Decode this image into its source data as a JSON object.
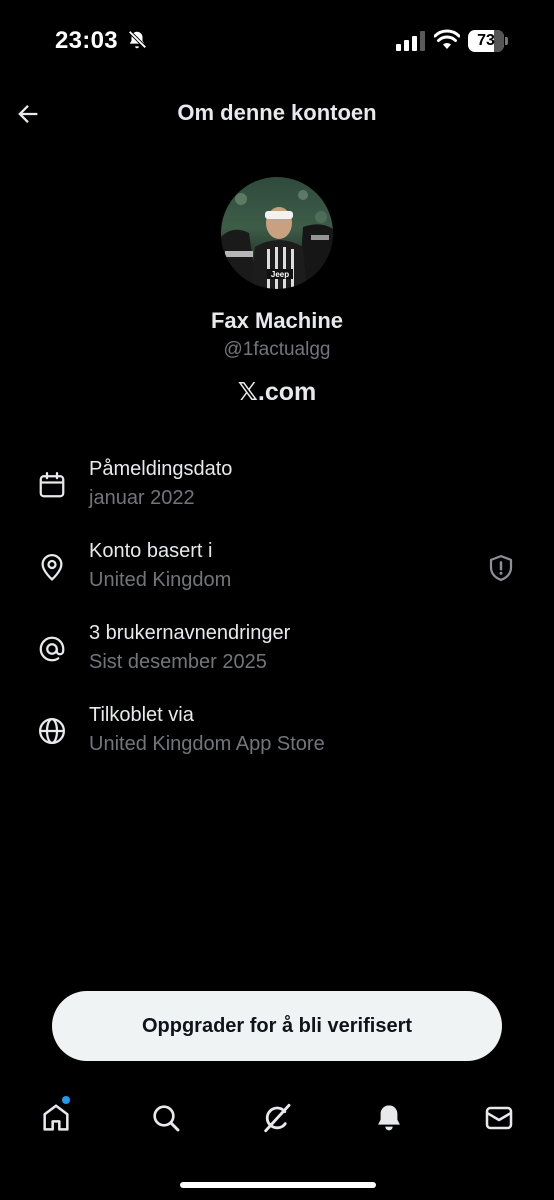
{
  "status_bar": {
    "time": "23:03",
    "battery_percent": 73
  },
  "header": {
    "title": "Om denne kontoen",
    "back_icon": "arrow-left-icon"
  },
  "profile": {
    "display_name": "Fax Machine",
    "handle": "@1factualgg",
    "site": "𝕏.com"
  },
  "info_items": [
    {
      "icon": "calendar-icon",
      "title": "Påmeldingsdato",
      "subtitle": "januar 2022"
    },
    {
      "icon": "location-pin-icon",
      "title": "Konto basert i",
      "subtitle": "United Kingdom",
      "trailing_icon": "shield-exclamation-icon"
    },
    {
      "icon": "at-sign-icon",
      "title": "3 brukernavnendringer",
      "subtitle": "Sist desember 2025"
    },
    {
      "icon": "globe-icon",
      "title": "Tilkoblet via",
      "subtitle": "United Kingdom App Store"
    }
  ],
  "upgrade_button": {
    "label": "Oppgrader for å bli verifisert"
  },
  "bottom_nav": [
    {
      "icon": "home-icon",
      "has_notification_dot": true
    },
    {
      "icon": "search-icon"
    },
    {
      "icon": "grok-icon"
    },
    {
      "icon": "bell-icon"
    },
    {
      "icon": "mail-icon"
    }
  ],
  "colors": {
    "background": "#000000",
    "primary_text": "#e7e9ea",
    "secondary_text": "#71767b",
    "button_bg": "#eff3f4",
    "accent_dot": "#1d9bf0"
  }
}
